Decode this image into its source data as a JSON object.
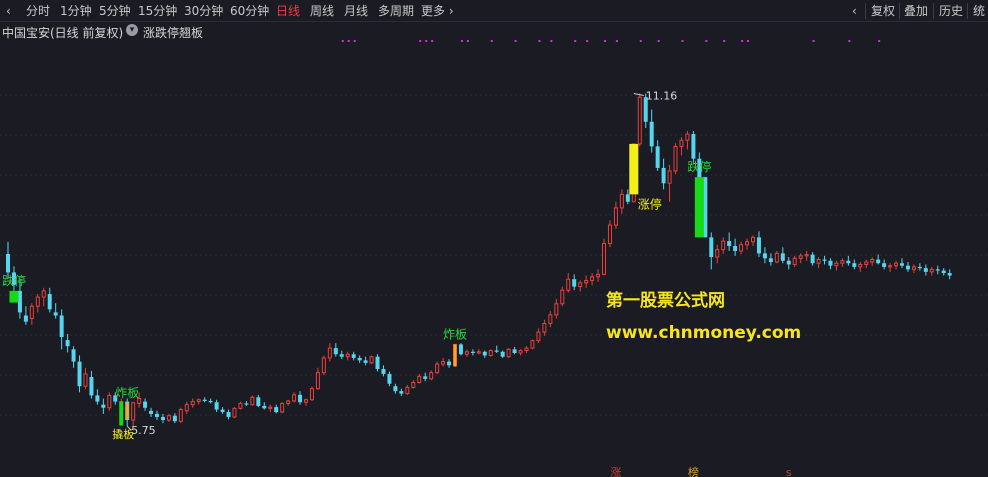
{
  "toolbar": {
    "periods": [
      "分时",
      "1分钟",
      "5分钟",
      "15分钟",
      "30分钟",
      "60分钟",
      "日线",
      "周线",
      "月线",
      "多周期",
      "更多"
    ],
    "active_period": "日线",
    "right_buttons": [
      "复权",
      "叠加",
      "历史",
      "统"
    ]
  },
  "infobar": {
    "stock_title": "中国宝安(日线 前复权)",
    "indicator_name": "涨跌停翘板"
  },
  "colors": {
    "background": "#1b1c23",
    "up_candle": "#e8413c",
    "down_candle": "#55d6f0",
    "limit_up_bar": "#f5ef1a",
    "limit_down_bar": "#18d917",
    "zha_bar": "#f5a623",
    "label_green": "#28d83e",
    "label_yellow": "#f5ef1a",
    "marker_magenta": "#cc33cc",
    "watermark": "#f5e51e"
  },
  "chart_data": {
    "type": "candlestick",
    "ylim": [
      5.2,
      11.9
    ],
    "x": [
      1,
      2,
      3,
      4,
      5,
      6,
      7,
      8,
      9,
      10,
      11,
      12,
      13,
      14,
      15,
      16,
      17,
      18,
      19,
      20,
      21,
      22,
      23,
      24,
      25,
      26,
      27,
      28,
      29,
      30,
      31,
      32,
      33,
      34,
      35,
      36,
      37,
      38,
      39,
      40,
      41,
      42,
      43,
      44,
      45,
      46,
      47,
      48,
      49,
      50,
      51,
      52,
      53,
      54,
      55,
      56,
      57,
      58,
      59,
      60,
      61,
      62,
      63,
      64,
      65,
      66,
      67,
      68,
      69,
      70,
      71,
      72,
      73,
      74,
      75,
      76,
      77,
      78,
      79,
      80,
      81,
      82,
      83,
      84,
      85,
      86,
      87,
      88,
      89,
      90,
      91,
      92,
      93,
      94,
      95,
      96,
      97,
      98,
      99,
      100,
      101,
      102,
      103,
      104,
      105,
      106,
      107,
      108,
      109,
      110,
      111,
      112,
      113,
      114,
      115,
      116,
      117,
      118,
      119,
      120,
      121,
      122,
      123,
      124,
      125,
      126,
      127,
      128,
      129,
      130,
      131,
      132,
      133,
      134,
      135,
      136,
      137,
      138,
      139,
      140,
      141,
      142,
      143,
      144,
      145,
      146,
      147,
      148,
      149,
      150,
      151,
      152,
      153,
      154,
      155,
      156,
      157,
      158,
      159,
      160,
      161,
      162,
      163,
      164
    ],
    "ohlc": [
      [
        8.55,
        8.75,
        8.15,
        8.25
      ],
      [
        8.25,
        8.35,
        7.95,
        8.05
      ],
      [
        7.95,
        8.15,
        7.5,
        7.6
      ],
      [
        7.55,
        7.7,
        7.4,
        7.45
      ],
      [
        7.5,
        7.75,
        7.4,
        7.7
      ],
      [
        7.7,
        7.9,
        7.6,
        7.85
      ],
      [
        7.85,
        8.0,
        7.7,
        7.95
      ],
      [
        7.9,
        8.0,
        7.6,
        7.65
      ],
      [
        7.6,
        7.75,
        7.5,
        7.55
      ],
      [
        7.55,
        7.65,
        7.0,
        7.2
      ],
      [
        7.15,
        7.25,
        6.95,
        7.05
      ],
      [
        7.0,
        7.05,
        6.7,
        6.8
      ],
      [
        6.8,
        6.9,
        6.3,
        6.4
      ],
      [
        6.4,
        6.7,
        6.35,
        6.6
      ],
      [
        6.55,
        6.65,
        6.2,
        6.25
      ],
      [
        6.25,
        6.35,
        6.1,
        6.15
      ],
      [
        6.1,
        6.2,
        5.95,
        6.05
      ],
      [
        6.05,
        6.3,
        6.0,
        6.25
      ],
      [
        6.25,
        6.3,
        6.1,
        6.15
      ],
      [
        6.15,
        6.2,
        6.1,
        6.15
      ],
      [
        6.15,
        6.2,
        5.75,
        5.85
      ],
      [
        5.85,
        6.15,
        5.75,
        6.13
      ],
      [
        6.12,
        6.3,
        6.05,
        6.2
      ],
      [
        6.15,
        6.2,
        6.0,
        6.05
      ],
      [
        6.0,
        6.05,
        5.9,
        5.95
      ],
      [
        5.95,
        6.0,
        5.85,
        5.9
      ],
      [
        5.9,
        5.95,
        5.8,
        5.85
      ],
      [
        5.85,
        5.95,
        5.82,
        5.92
      ],
      [
        5.92,
        5.96,
        5.8,
        5.83
      ],
      [
        5.83,
        6.05,
        5.8,
        6.02
      ],
      [
        6.0,
        6.15,
        5.95,
        6.1
      ],
      [
        6.1,
        6.2,
        6.05,
        6.15
      ],
      [
        6.15,
        6.2,
        6.1,
        6.18
      ],
      [
        6.18,
        6.22,
        6.14,
        6.16
      ],
      [
        6.16,
        6.2,
        6.12,
        6.14
      ],
      [
        6.14,
        6.18,
        5.98,
        6.02
      ],
      [
        6.02,
        6.06,
        5.95,
        5.98
      ],
      [
        5.98,
        6.02,
        5.86,
        5.9
      ],
      [
        5.9,
        6.06,
        5.88,
        6.04
      ],
      [
        6.04,
        6.15,
        6.02,
        6.12
      ],
      [
        6.12,
        6.16,
        6.08,
        6.1
      ],
      [
        6.1,
        6.25,
        6.08,
        6.22
      ],
      [
        6.22,
        6.26,
        6.06,
        6.08
      ],
      [
        6.08,
        6.14,
        6.02,
        6.04
      ],
      [
        6.04,
        6.1,
        5.98,
        6.06
      ],
      [
        6.06,
        6.1,
        5.96,
        5.98
      ],
      [
        5.98,
        6.14,
        5.96,
        6.12
      ],
      [
        6.12,
        6.18,
        6.08,
        6.16
      ],
      [
        6.16,
        6.3,
        6.14,
        6.26
      ],
      [
        6.26,
        6.32,
        6.1,
        6.14
      ],
      [
        6.14,
        6.2,
        6.08,
        6.18
      ],
      [
        6.18,
        6.4,
        6.16,
        6.36
      ],
      [
        6.36,
        6.7,
        6.34,
        6.62
      ],
      [
        6.62,
        6.9,
        6.58,
        6.86
      ],
      [
        6.86,
        7.1,
        6.8,
        7.02
      ],
      [
        7.02,
        7.1,
        6.88,
        6.92
      ],
      [
        6.92,
        6.98,
        6.84,
        6.88
      ],
      [
        6.88,
        6.96,
        6.82,
        6.92
      ],
      [
        6.92,
        6.96,
        6.82,
        6.86
      ],
      [
        6.86,
        6.9,
        6.78,
        6.82
      ],
      [
        6.82,
        6.88,
        6.74,
        6.78
      ],
      [
        6.78,
        6.9,
        6.76,
        6.88
      ],
      [
        6.88,
        6.92,
        6.64,
        6.68
      ],
      [
        6.68,
        6.74,
        6.56,
        6.6
      ],
      [
        6.6,
        6.64,
        6.4,
        6.44
      ],
      [
        6.4,
        6.44,
        6.28,
        6.32
      ],
      [
        6.32,
        6.36,
        6.24,
        6.28
      ],
      [
        6.28,
        6.42,
        6.26,
        6.38
      ],
      [
        6.38,
        6.5,
        6.36,
        6.46
      ],
      [
        6.46,
        6.6,
        6.44,
        6.56
      ],
      [
        6.56,
        6.62,
        6.48,
        6.52
      ],
      [
        6.52,
        6.66,
        6.5,
        6.62
      ],
      [
        6.62,
        6.8,
        6.6,
        6.76
      ],
      [
        6.76,
        6.86,
        6.72,
        6.8
      ],
      [
        6.8,
        6.84,
        6.7,
        6.74
      ],
      [
        6.74,
        7.08,
        6.74,
        7.08
      ],
      [
        7.08,
        7.1,
        6.9,
        6.92
      ],
      [
        6.92,
        7.0,
        6.88,
        6.96
      ],
      [
        6.96,
        7.0,
        6.9,
        6.94
      ],
      [
        6.94,
        7.0,
        6.92,
        6.96
      ],
      [
        6.96,
        6.98,
        6.86,
        6.9
      ],
      [
        6.9,
        7.0,
        6.88,
        6.98
      ],
      [
        6.98,
        7.06,
        6.94,
        6.96
      ],
      [
        6.96,
        6.98,
        6.86,
        6.88
      ],
      [
        6.88,
        7.02,
        6.86,
        7.0
      ],
      [
        7.0,
        7.04,
        6.92,
        6.94
      ],
      [
        6.94,
        7.0,
        6.9,
        6.98
      ],
      [
        6.98,
        7.05,
        6.94,
        7.02
      ],
      [
        7.02,
        7.16,
        7.0,
        7.14
      ],
      [
        7.14,
        7.34,
        7.1,
        7.28
      ],
      [
        7.28,
        7.48,
        7.22,
        7.42
      ],
      [
        7.42,
        7.62,
        7.36,
        7.56
      ],
      [
        7.56,
        7.82,
        7.5,
        7.74
      ],
      [
        7.74,
        8.02,
        7.7,
        7.96
      ],
      [
        7.96,
        8.24,
        7.92,
        8.14
      ],
      [
        8.14,
        8.22,
        7.96,
        8.02
      ],
      [
        8.02,
        8.12,
        7.94,
        8.08
      ],
      [
        8.08,
        8.2,
        8.0,
        8.12
      ],
      [
        8.12,
        8.24,
        8.04,
        8.18
      ],
      [
        8.18,
        8.3,
        8.1,
        8.22
      ],
      [
        8.22,
        8.8,
        8.2,
        8.72
      ],
      [
        8.72,
        9.1,
        8.66,
        9.02
      ],
      [
        9.02,
        9.4,
        8.96,
        9.3
      ],
      [
        9.3,
        9.6,
        9.2,
        9.52
      ],
      [
        9.52,
        9.6,
        9.36,
        9.4
      ],
      [
        9.4,
        10.34,
        9.4,
        10.34
      ],
      [
        10.34,
        11.16,
        10.3,
        11.1
      ],
      [
        11.1,
        11.16,
        10.6,
        10.7
      ],
      [
        10.7,
        10.9,
        10.2,
        10.3
      ],
      [
        10.3,
        10.4,
        9.9,
        9.95
      ],
      [
        9.95,
        10.1,
        9.6,
        9.7
      ],
      [
        9.7,
        10.0,
        9.4,
        9.9
      ],
      [
        9.9,
        10.35,
        9.85,
        10.3
      ],
      [
        10.3,
        10.45,
        10.15,
        10.4
      ],
      [
        10.4,
        10.55,
        10.25,
        10.5
      ],
      [
        10.5,
        10.55,
        10.05,
        10.1
      ],
      [
        10.1,
        10.2,
        9.7,
        9.8
      ],
      [
        9.8,
        9.8,
        8.82,
        8.82
      ],
      [
        8.82,
        8.9,
        8.3,
        8.5
      ],
      [
        8.5,
        8.7,
        8.4,
        8.62
      ],
      [
        8.62,
        8.82,
        8.55,
        8.76
      ],
      [
        8.76,
        8.9,
        8.6,
        8.68
      ],
      [
        8.68,
        8.8,
        8.52,
        8.6
      ],
      [
        8.6,
        8.75,
        8.55,
        8.7
      ],
      [
        8.7,
        8.8,
        8.62,
        8.75
      ],
      [
        8.75,
        8.85,
        8.68,
        8.82
      ],
      [
        8.82,
        8.92,
        8.5,
        8.56
      ],
      [
        8.56,
        8.66,
        8.4,
        8.48
      ],
      [
        8.48,
        8.56,
        8.36,
        8.42
      ],
      [
        8.42,
        8.6,
        8.4,
        8.56
      ],
      [
        8.56,
        8.66,
        8.4,
        8.44
      ],
      [
        8.44,
        8.5,
        8.3,
        8.38
      ],
      [
        8.38,
        8.52,
        8.34,
        8.48
      ],
      [
        8.48,
        8.56,
        8.4,
        8.52
      ],
      [
        8.52,
        8.6,
        8.44,
        8.54
      ],
      [
        8.54,
        8.58,
        8.36,
        8.4
      ],
      [
        8.4,
        8.5,
        8.32,
        8.46
      ],
      [
        8.46,
        8.52,
        8.38,
        8.44
      ],
      [
        8.44,
        8.48,
        8.3,
        8.36
      ],
      [
        8.36,
        8.44,
        8.28,
        8.4
      ],
      [
        8.4,
        8.48,
        8.34,
        8.44
      ],
      [
        8.44,
        8.52,
        8.36,
        8.4
      ],
      [
        8.4,
        8.46,
        8.3,
        8.34
      ],
      [
        8.34,
        8.42,
        8.26,
        8.38
      ],
      [
        8.38,
        8.46,
        8.32,
        8.42
      ],
      [
        8.42,
        8.5,
        8.36,
        8.46
      ],
      [
        8.46,
        8.54,
        8.38,
        8.4
      ],
      [
        8.4,
        8.46,
        8.3,
        8.34
      ],
      [
        8.34,
        8.4,
        8.26,
        8.36
      ],
      [
        8.36,
        8.44,
        8.3,
        8.4
      ],
      [
        8.4,
        8.48,
        8.32,
        8.36
      ],
      [
        8.36,
        8.42,
        8.26,
        8.3
      ],
      [
        8.3,
        8.38,
        8.24,
        8.34
      ],
      [
        8.34,
        8.4,
        8.28,
        8.32
      ],
      [
        8.32,
        8.38,
        8.2,
        8.26
      ],
      [
        8.26,
        8.34,
        8.2,
        8.3
      ],
      [
        8.3,
        8.36,
        8.22,
        8.28
      ],
      [
        8.28,
        8.32,
        8.2,
        8.24
      ],
      [
        8.24,
        8.3,
        8.14,
        8.2
      ]
    ],
    "indicator_bars": [
      {
        "label": "跌停",
        "type": "limit-down",
        "x": 2,
        "top": 7.95,
        "bottom": 7.76,
        "label_color": "label_green"
      },
      {
        "label": "炸板",
        "type": "zha",
        "x": 21,
        "top": 6.13,
        "bottom": 5.87,
        "label_color": "label_green"
      },
      {
        "label": "炸板",
        "type": "zha",
        "x": 76,
        "top": 7.08,
        "bottom": 6.72,
        "label_color": "label_green"
      },
      {
        "label": "涨停",
        "type": "limit-up",
        "x": 106,
        "top": 10.34,
        "bottom": 9.52,
        "label_color": "label_yellow"
      },
      {
        "label": "跌停",
        "type": "limit-down",
        "x": 117,
        "top": 9.8,
        "bottom": 8.82,
        "label_color": "label_green"
      }
    ],
    "bottom_labels": [
      "撬板"
    ],
    "price_annotations": [
      "11.16",
      "5.75"
    ],
    "bottom_markers": [
      {
        "text": "涨",
        "x": 103
      },
      {
        "text": "榜",
        "x": 116
      },
      {
        "text": "s",
        "x": 132
      }
    ],
    "top_dots_x": [
      57,
      58,
      59,
      70,
      71,
      72,
      77,
      78,
      82,
      86,
      90,
      92,
      96,
      98,
      101,
      103,
      107,
      110,
      114,
      118,
      121,
      124,
      125,
      136,
      142,
      147
    ]
  },
  "watermark": {
    "line1": "第一股票公式网",
    "line2": "www.chnmoney.com"
  }
}
